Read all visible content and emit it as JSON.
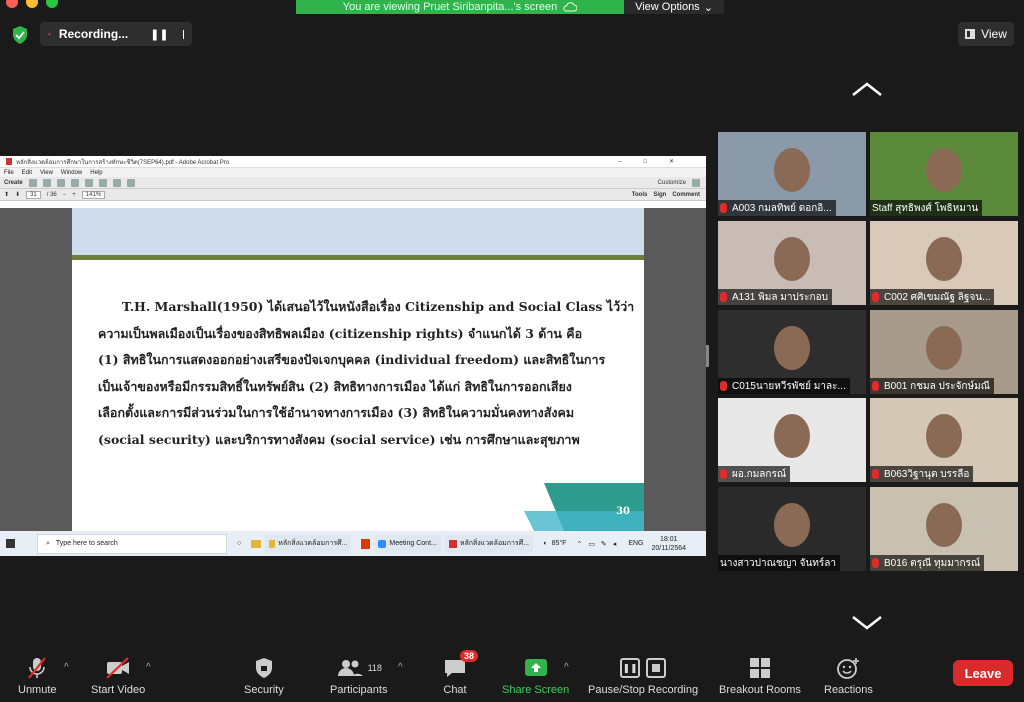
{
  "window": {
    "traffic_lights": [
      "#ff5f57",
      "#febc2e",
      "#28c840"
    ]
  },
  "share_banner": {
    "text": "You are viewing Pruet Siribanpita...'s screen",
    "view_options": "View Options"
  },
  "recording": {
    "label": "Recording..."
  },
  "view_button": {
    "label": "View"
  },
  "shared": {
    "acrobat_title": "หลักสิ่งแวดล้อมการศึกษาในการสร้างทักษะชีวิต(7SEP64).pdf - Adobe Acrobat Pro",
    "menu": [
      "File",
      "Edit",
      "View",
      "Window",
      "Help"
    ],
    "toolbar": {
      "create": "Create",
      "page": "31",
      "pages": "/ 36",
      "zoom": "141%",
      "customize": "Customize",
      "tools": "Tools",
      "sign": "Sign",
      "comment": "Comment"
    },
    "slide_lines": [
      "T.H. Marshall(1950) ได้เสนอไว้ในหนังสือเรื่อง Citizenship and Social Class ไว้ว่า",
      "ความเป็นพลเมืองเป็นเรื่องของสิทธิพลเมือง (citizenship rights) จำแนกได้ 3 ด้าน คือ",
      "(1) สิทธิในการแสดงออกอย่างเสรีของปัจเจกบุคคล (individual freedom) และสิทธิในการ",
      "เป็นเจ้าของหรือมีกรรมสิทธิ์ในทรัพย์สิน (2) สิทธิทางการเมือง ได้แก่ สิทธิในการออกเสียง",
      "เลือกตั้งและการมีส่วนร่วมในการใช้อำนาจทางการเมือง (3) สิทธิในความมั่นคงทางสังคม",
      "(social security) และบริการทางสังคม (social service) เช่น การศึกษาและสุขภาพ"
    ],
    "slide_number": "30",
    "taskbar": {
      "search": "Type here to search",
      "apps": [
        "หลักสิ่งแวดล้อมการศึ...",
        "Meeting Cont...",
        "หลักสิ่งแวดล้อมการศึ..."
      ],
      "weather": "85°F",
      "lang": "ENG",
      "time": "18:01",
      "date": "20/11/2564"
    }
  },
  "participants": [
    {
      "name": "A003 กมลทิพย์ ดอกอิ...",
      "muted": true,
      "bg": "#8a9aa8"
    },
    {
      "name": "Staff สุทธิพงศ์ โพธิหมาน",
      "muted": false,
      "bg": "#5a8a3a"
    },
    {
      "name": "A131 พิมล  มาประกอบ",
      "muted": true,
      "bg": "#c9bcb4"
    },
    {
      "name": "C002 ศศิเขมณัฐ ลิฐจน...",
      "muted": true,
      "bg": "#d8c9b8"
    },
    {
      "name": "C015นายหวีรพัชย์ มาละ...",
      "muted": true,
      "bg": "#2e2e2e"
    },
    {
      "name": "B001 กชมล ประจักษ์มณี",
      "muted": true,
      "bg": "#a89a8a"
    },
    {
      "name": "ผอ.กมลกรณ์",
      "muted": true,
      "bg": "#e8e8e8"
    },
    {
      "name": "B063วิฐานุต บรรลือ",
      "muted": true,
      "bg": "#d5c7b5"
    },
    {
      "name": "นางสาวปาณชญา  จันทร์ลา",
      "muted": false,
      "bg": "#2a2a2a"
    },
    {
      "name": "B016 ตรุณี ทุมมากรณ์",
      "muted": true,
      "bg": "#c8c0b0"
    }
  ],
  "controls": {
    "unmute": "Unmute",
    "start_video": "Start Video",
    "security": "Security",
    "participants": "Participants",
    "participants_count": "118",
    "chat": "Chat",
    "chat_badge": "38",
    "share_screen": "Share Screen",
    "pause_recording": "Pause/Stop Recording",
    "breakout": "Breakout Rooms",
    "reactions": "Reactions",
    "leave": "Leave"
  },
  "colors": {
    "share_green": "#2fb34a",
    "leave_red": "#d92b2b",
    "mute_red": "#e02b2b"
  }
}
